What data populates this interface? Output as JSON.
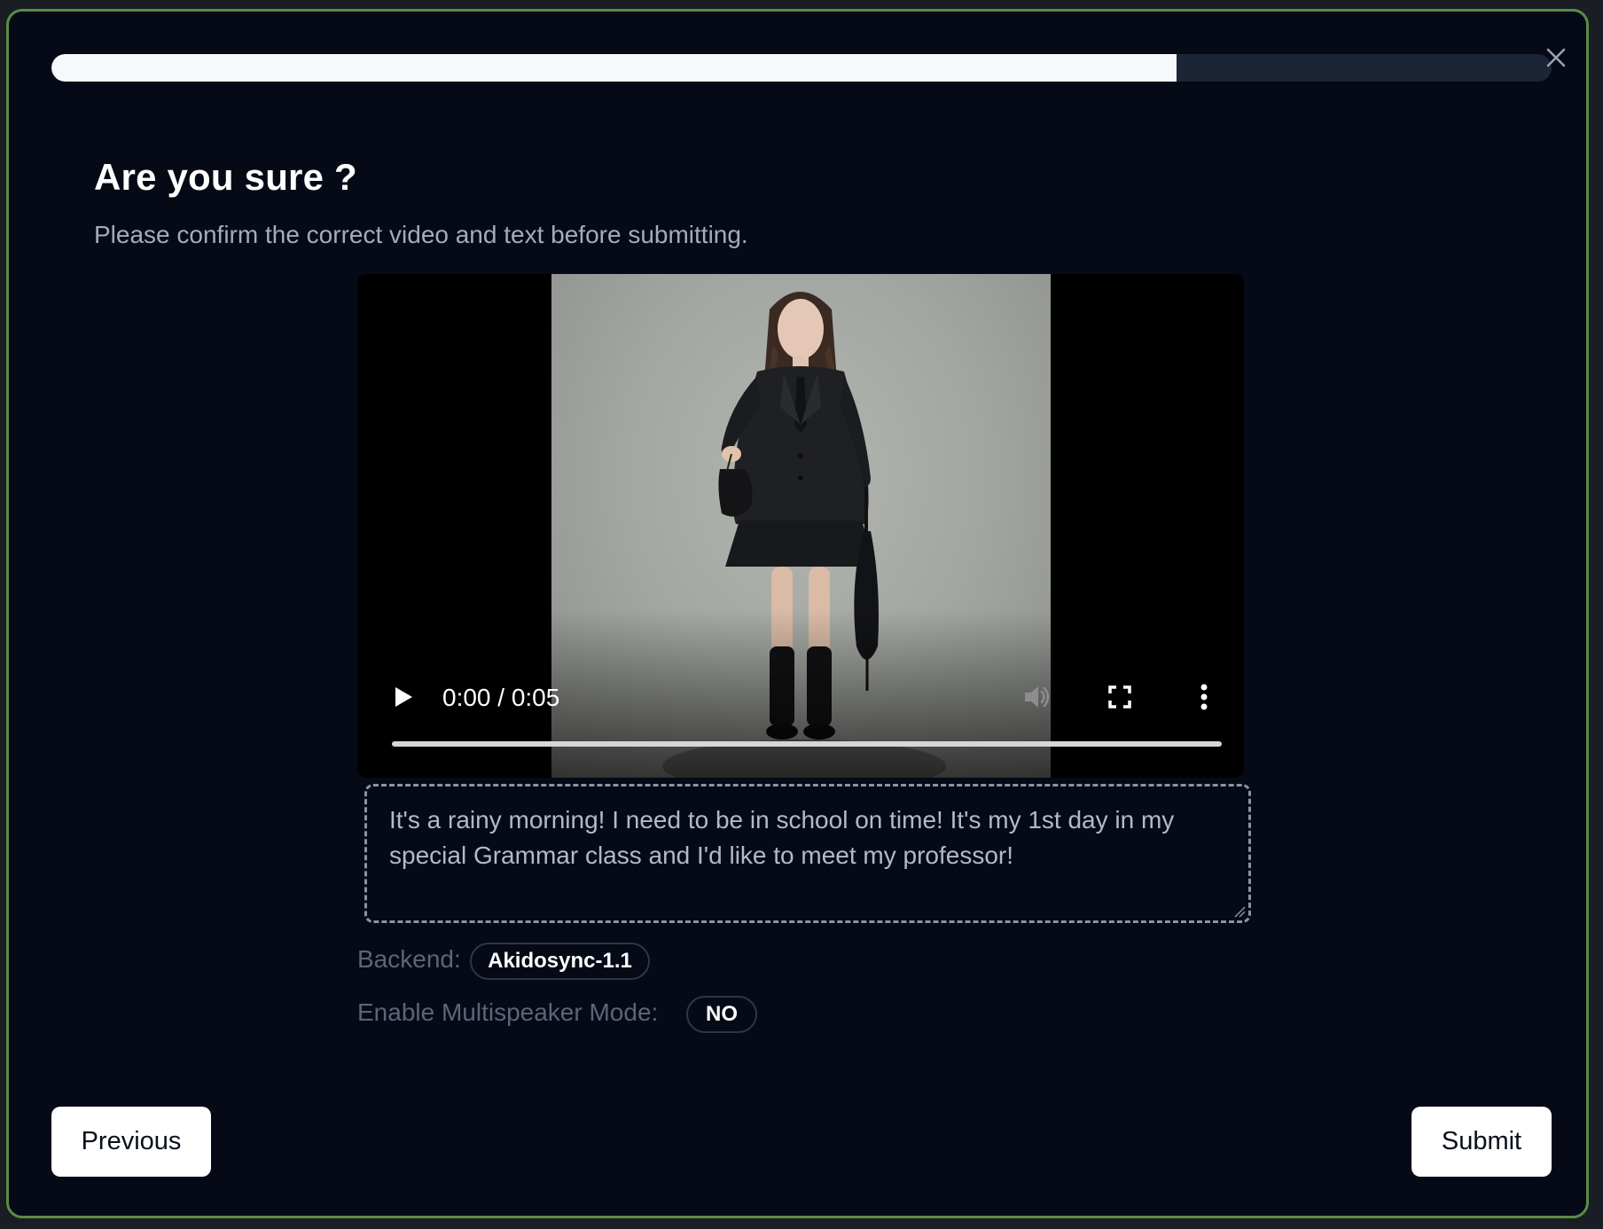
{
  "dialog": {
    "title": "Are you sure ?",
    "subtitle": "Please confirm the correct video and text before submitting.",
    "progress_fraction": 0.75
  },
  "video_player": {
    "time_display": "0:00 / 0:05",
    "icons": {
      "play": "play-icon",
      "volume": "volume-icon",
      "fullscreen": "fullscreen-icon",
      "more": "more-options-icon"
    }
  },
  "script_text": "It's a rainy morning! I need to be in school on time! It's my 1st day in my special Grammar class and I'd like to meet my professor!",
  "settings": {
    "backend_label": "Backend:",
    "backend_value": "Akidosync-1.1",
    "multispeaker_label": "Enable Multispeaker Mode:",
    "multispeaker_value": "NO"
  },
  "footer": {
    "previous_label": "Previous",
    "submit_label": "Submit"
  },
  "colors": {
    "background": "#050a16",
    "border_accent": "#5a8c45",
    "progress_fill": "#f7f8fa",
    "progress_track": "#1c2536"
  }
}
